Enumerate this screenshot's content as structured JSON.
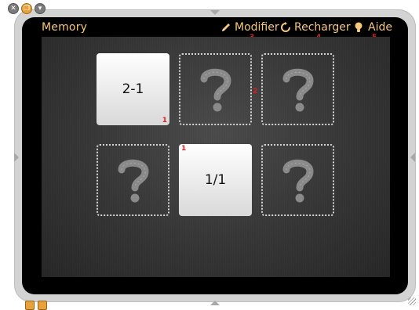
{
  "window": {
    "controls": [
      {
        "icon": "close-icon",
        "glyph": "✕"
      },
      {
        "icon": "duplicate-icon",
        "glyph": "❐"
      },
      {
        "icon": "minimize-icon",
        "glyph": "▾"
      }
    ]
  },
  "app": {
    "title": "Memory"
  },
  "toolbar": {
    "edit_label": "Modifier",
    "reload_label": "Recharger",
    "help_label": "Aide",
    "edit_badge": "3",
    "reload_badge": "4",
    "help_badge": "5",
    "accent": "#f6c77d"
  },
  "board": {
    "cards": [
      {
        "state": "face-up",
        "text": "2-1",
        "badge": "1"
      },
      {
        "state": "face-down",
        "text": "",
        "badge": "2"
      },
      {
        "state": "face-down",
        "text": "",
        "badge": ""
      },
      {
        "state": "face-down",
        "text": "",
        "badge": ""
      },
      {
        "state": "face-up",
        "text": "1/1",
        "badge": "1"
      },
      {
        "state": "face-down",
        "text": "",
        "badge": ""
      }
    ],
    "badge_color": "#e02020"
  }
}
